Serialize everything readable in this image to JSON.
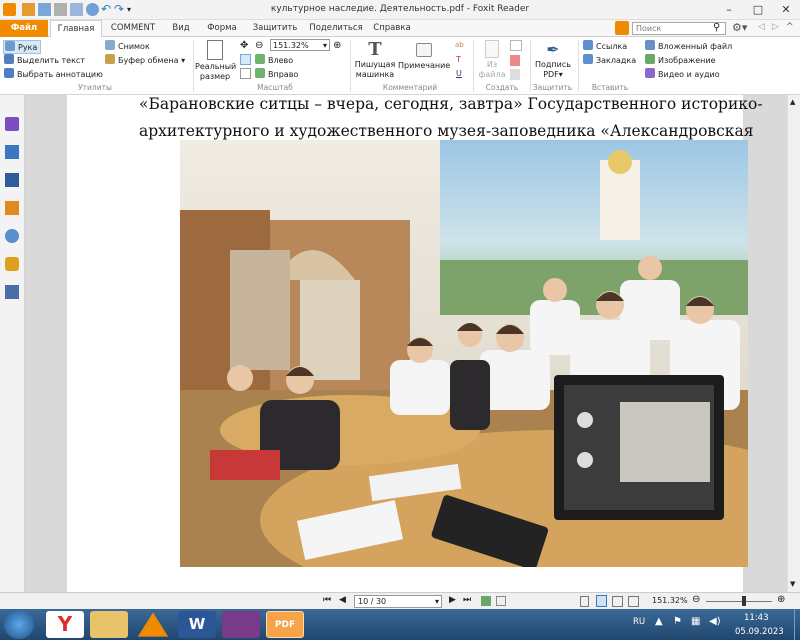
{
  "window": {
    "title": "культурное наследие. Деятельность.pdf - Foxit Reader"
  },
  "tabs": [
    "Файл",
    "Главная",
    "COMMENT",
    "Вид",
    "Форма",
    "Защитить",
    "Поделиться",
    "Справка"
  ],
  "search_placeholder": "Поиск",
  "ribbon": {
    "util": {
      "hand": "Рука",
      "select_text": "Выделить текст",
      "select_annot": "Выбрать аннотацию",
      "snapshot": "Снимок",
      "clipboard": "Буфер обмена",
      "group": "Утилиты"
    },
    "scale": {
      "actual_size": "Реальный размер",
      "zoom_value": "151.32%",
      "left": "Влево",
      "right": "Вправо",
      "group": "Масштаб"
    },
    "comments": {
      "typewriter": "Пишущая машинка",
      "note": "Примечание",
      "group": "Комментарий"
    },
    "create": {
      "from_file": "Из файла",
      "group": "Создать"
    },
    "protect": {
      "sign": "Подпись PDF",
      "group": "Защитить"
    },
    "insert": {
      "link": "Ссылка",
      "bookmark": "Закладка",
      "attachment": "Вложенный файл",
      "image": "Изображение",
      "video": "Видео и аудио",
      "group": "Вставить"
    }
  },
  "document": {
    "line1": "«Барановские ситцы – вчера, сегодня, завтра» Государственного историко-",
    "line2": "архитектурного и художественного музея-заповедника «Александровская"
  },
  "status": {
    "page": "10 / 30",
    "zoom": "151.32%"
  },
  "taskbar": {
    "lang": "RU",
    "time": "11:43",
    "date": "05.09.2023"
  }
}
